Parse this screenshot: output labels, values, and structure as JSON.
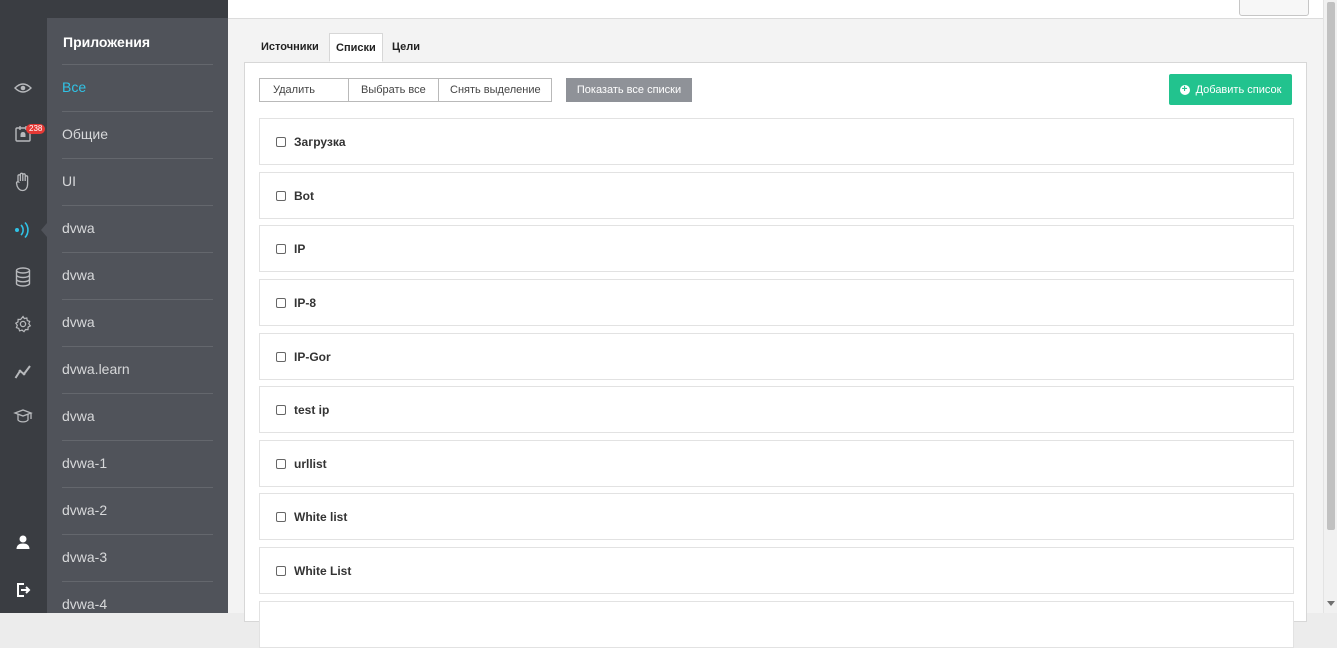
{
  "sidebar": {
    "badge_count": "238",
    "icons": [
      "eye-icon",
      "notification-bell-icon",
      "hand-icon",
      "broadcast-icon",
      "database-icon",
      "gear-icon",
      "chart-line-icon",
      "graduation-cap-icon",
      "user-icon",
      "logout-icon"
    ]
  },
  "apps": {
    "title": "Приложения",
    "items": [
      {
        "label": "Все"
      },
      {
        "label": "Общие"
      },
      {
        "label": "UI"
      },
      {
        "label": "dvwa"
      },
      {
        "label": "dvwa"
      },
      {
        "label": "dvwa"
      },
      {
        "label": "dvwa.learn"
      },
      {
        "label": "dvwa"
      },
      {
        "label": "dvwa-1"
      },
      {
        "label": "dvwa-2"
      },
      {
        "label": "dvwa-3"
      },
      {
        "label": "dvwa-4"
      }
    ]
  },
  "tabs": {
    "sources": "Источники",
    "lists": "Списки",
    "goals": "Цели"
  },
  "toolbar": {
    "delete": "Удалить",
    "select_all": "Выбрать все",
    "deselect": "Снять выделение",
    "show_all": "Показать все списки",
    "add_list": "Добавить список"
  },
  "lists": [
    {
      "label": "Загрузка"
    },
    {
      "label": "Bot"
    },
    {
      "label": "IP"
    },
    {
      "label": "IP-8"
    },
    {
      "label": "IP-Gor"
    },
    {
      "label": "test ip"
    },
    {
      "label": "urllist"
    },
    {
      "label": "White list"
    },
    {
      "label": "White List"
    }
  ],
  "colors": {
    "accent_cyan": "#30c3e6",
    "add_button_green": "#22c38e",
    "badge_red": "#e53935"
  }
}
